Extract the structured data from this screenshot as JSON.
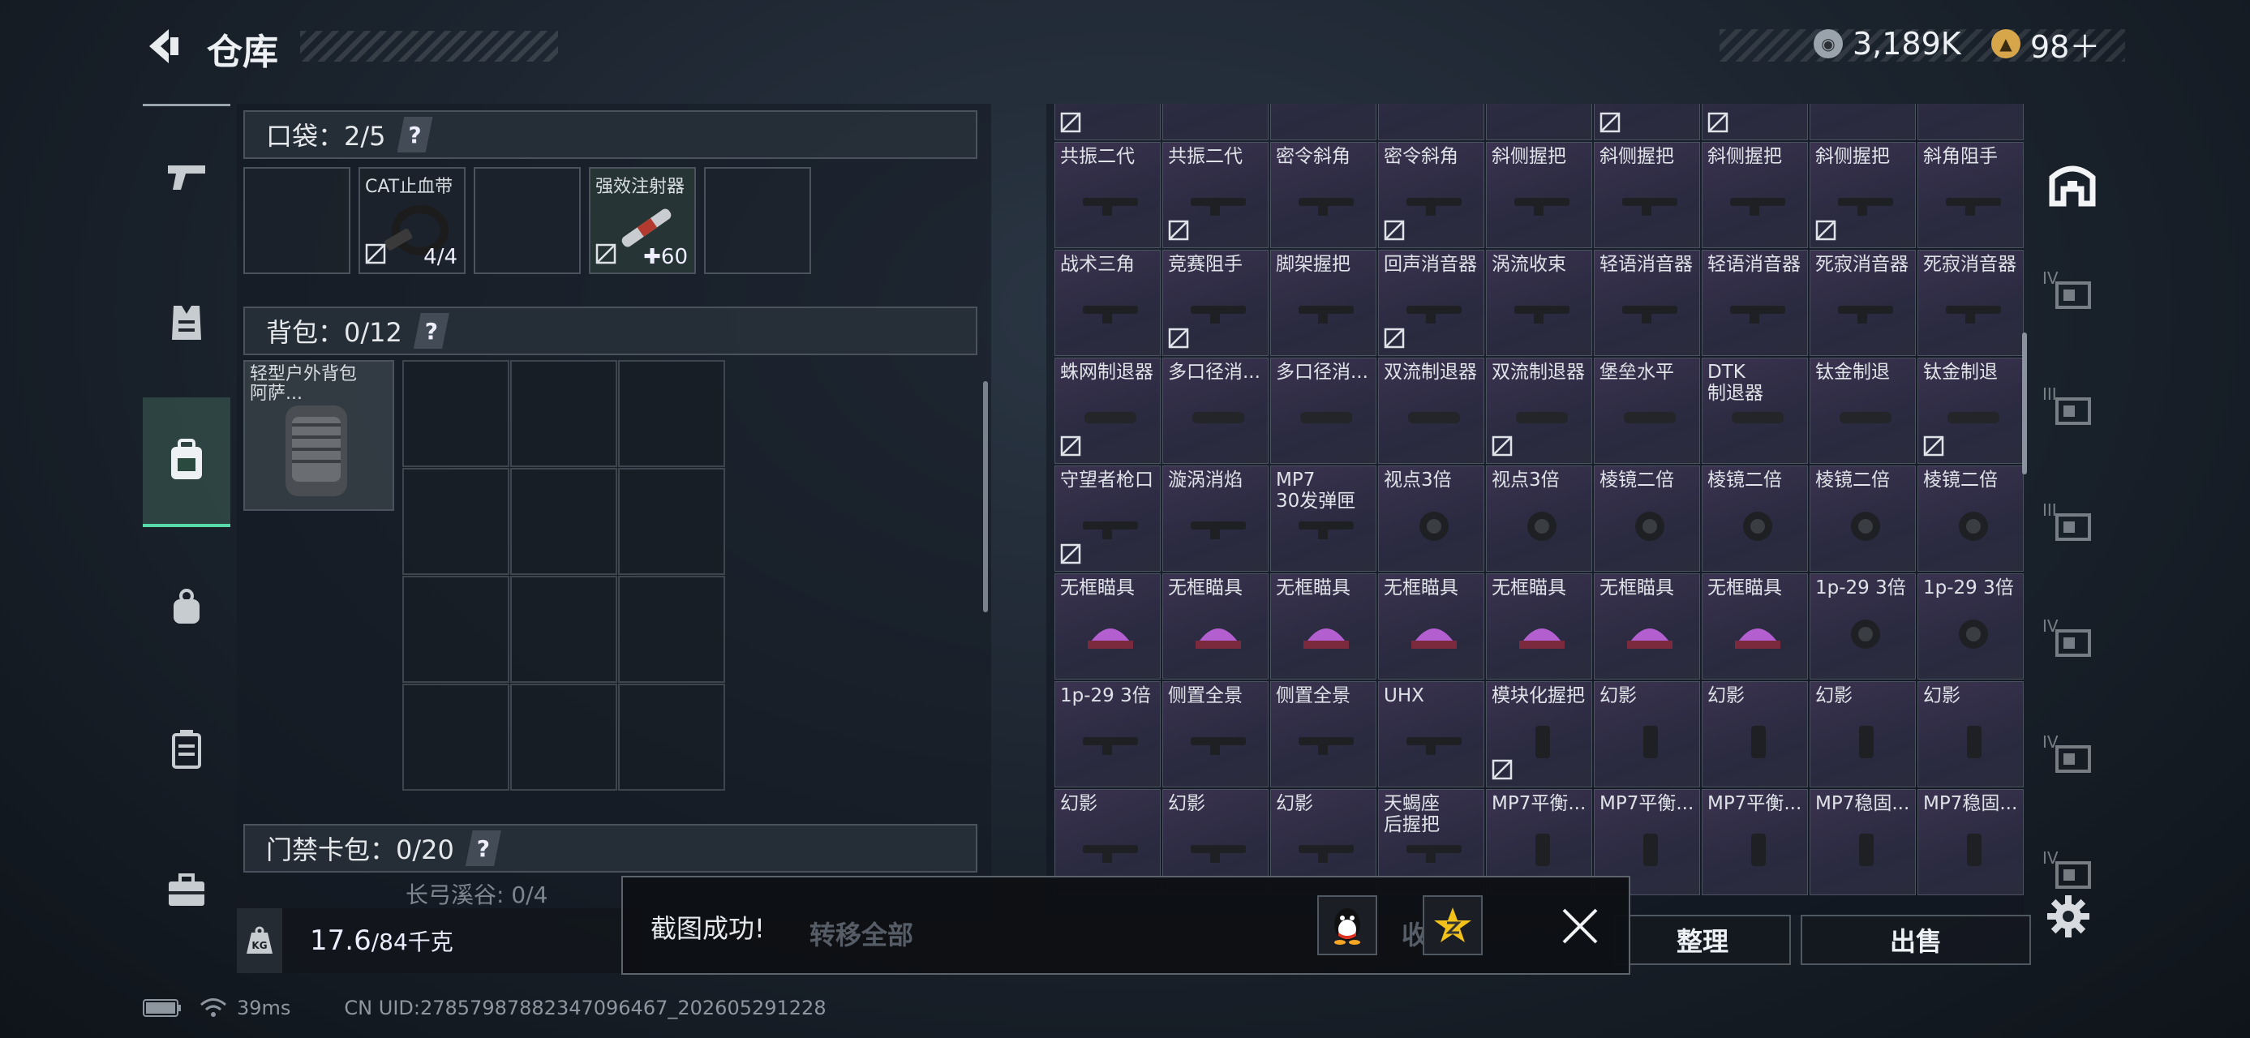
{
  "header": {
    "title": "仓库",
    "currency_silver": "3,189K",
    "currency_gold": "98＋"
  },
  "pockets": {
    "label": "口袋：2/5",
    "help": "?",
    "slots": [
      {
        "name": "",
        "qty": ""
      },
      {
        "name": "CAT止血带",
        "qty": "4/4"
      },
      {
        "name": "",
        "qty": ""
      },
      {
        "name": "强效注射器",
        "qty": "✚60"
      },
      {
        "name": "",
        "qty": ""
      }
    ]
  },
  "backpack": {
    "label": "背包：0/12",
    "help": "?",
    "item_name": "轻型户外背包\n阿萨..."
  },
  "keycard": {
    "label": "门禁卡包：0/20",
    "help": "?",
    "sub_label": "长弓溪谷: 0/4"
  },
  "weight": {
    "value": "17.6",
    "max": "/84千克"
  },
  "items": [
    {
      "name": "",
      "lock": true
    },
    {
      "name": "",
      "lock": false
    },
    {
      "name": "",
      "lock": false
    },
    {
      "name": "",
      "lock": false
    },
    {
      "name": "",
      "lock": false
    },
    {
      "name": "",
      "lock": true
    },
    {
      "name": "",
      "lock": true
    },
    {
      "name": "",
      "lock": false
    },
    {
      "name": "",
      "lock": false
    },
    {
      "name": "共振二代",
      "lock": false
    },
    {
      "name": "共振二代",
      "lock": true
    },
    {
      "name": "密令斜角",
      "lock": false
    },
    {
      "name": "密令斜角",
      "lock": true
    },
    {
      "name": "斜侧握把",
      "lock": false
    },
    {
      "name": "斜侧握把",
      "lock": false
    },
    {
      "name": "斜侧握把",
      "lock": false
    },
    {
      "name": "斜侧握把",
      "lock": true
    },
    {
      "name": "斜角阻手",
      "lock": false
    },
    {
      "name": "战术三角",
      "lock": false
    },
    {
      "name": "竞赛阻手",
      "lock": true
    },
    {
      "name": "脚架握把",
      "lock": false
    },
    {
      "name": "回声消音器",
      "lock": true
    },
    {
      "name": "涡流收束",
      "lock": false
    },
    {
      "name": "轻语消音器",
      "lock": false
    },
    {
      "name": "轻语消音器",
      "lock": false
    },
    {
      "name": "死寂消音器",
      "lock": false
    },
    {
      "name": "死寂消音器",
      "lock": false
    },
    {
      "name": "蛛网制退器",
      "lock": true
    },
    {
      "name": "多口径消...",
      "lock": false
    },
    {
      "name": "多口径消...",
      "lock": false
    },
    {
      "name": "双流制退器",
      "lock": false
    },
    {
      "name": "双流制退器",
      "lock": true
    },
    {
      "name": "堡垒水平",
      "lock": false
    },
    {
      "name": "DTK\n制退器",
      "lock": false
    },
    {
      "name": "钛金制退",
      "lock": false
    },
    {
      "name": "钛金制退",
      "lock": true
    },
    {
      "name": "守望者枪口",
      "lock": true
    },
    {
      "name": "漩涡消焰",
      "lock": false
    },
    {
      "name": "MP7\n30发弹匣",
      "lock": false
    },
    {
      "name": "视点3倍",
      "lock": false
    },
    {
      "name": "视点3倍",
      "lock": false
    },
    {
      "name": "棱镜二倍",
      "lock": false
    },
    {
      "name": "棱镜二倍",
      "lock": false
    },
    {
      "name": "棱镜二倍",
      "lock": false
    },
    {
      "name": "棱镜二倍",
      "lock": false
    },
    {
      "name": "无框瞄具",
      "lock": false
    },
    {
      "name": "无框瞄具",
      "lock": false
    },
    {
      "name": "无框瞄具",
      "lock": false
    },
    {
      "name": "无框瞄具",
      "lock": false
    },
    {
      "name": "无框瞄具",
      "lock": false
    },
    {
      "name": "无框瞄具",
      "lock": false
    },
    {
      "name": "无框瞄具",
      "lock": false
    },
    {
      "name": "1p-29 3倍",
      "lock": false
    },
    {
      "name": "1p-29 3倍",
      "lock": false
    },
    {
      "name": "1p-29 3倍",
      "lock": false
    },
    {
      "name": "侧置全景",
      "lock": false
    },
    {
      "name": "侧置全景",
      "lock": false
    },
    {
      "name": "UHX",
      "lock": false
    },
    {
      "name": "模块化握把",
      "lock": true
    },
    {
      "name": "幻影",
      "lock": false
    },
    {
      "name": "幻影",
      "lock": false
    },
    {
      "name": "幻影",
      "lock": false
    },
    {
      "name": "幻影",
      "lock": false
    },
    {
      "name": "幻影",
      "lock": false
    },
    {
      "name": "幻影",
      "lock": false
    },
    {
      "name": "幻影",
      "lock": false
    },
    {
      "name": "天蝎座\n后握把",
      "lock": false
    },
    {
      "name": "MP7平衡...",
      "lock": false
    },
    {
      "name": "MP7平衡...",
      "lock": false
    },
    {
      "name": "MP7平衡...",
      "lock": false
    },
    {
      "name": "MP7稳固...",
      "lock": false
    },
    {
      "name": "MP7稳固...",
      "lock": false
    }
  ],
  "right_rail": [
    "IV",
    "III",
    "III",
    "IV",
    "IV",
    "IV"
  ],
  "buttons": {
    "transfer_all": "转移全部",
    "collect": "收藏室",
    "sort": "整理",
    "sell": "出售"
  },
  "toast": {
    "message": "截图成功!"
  },
  "status": {
    "ping": "39ms",
    "uid": "CN UID:2785798788234709646​7_202605291228"
  },
  "colors": {
    "accent_green": "#57d9a8",
    "item_bg": "#2f2c45"
  }
}
